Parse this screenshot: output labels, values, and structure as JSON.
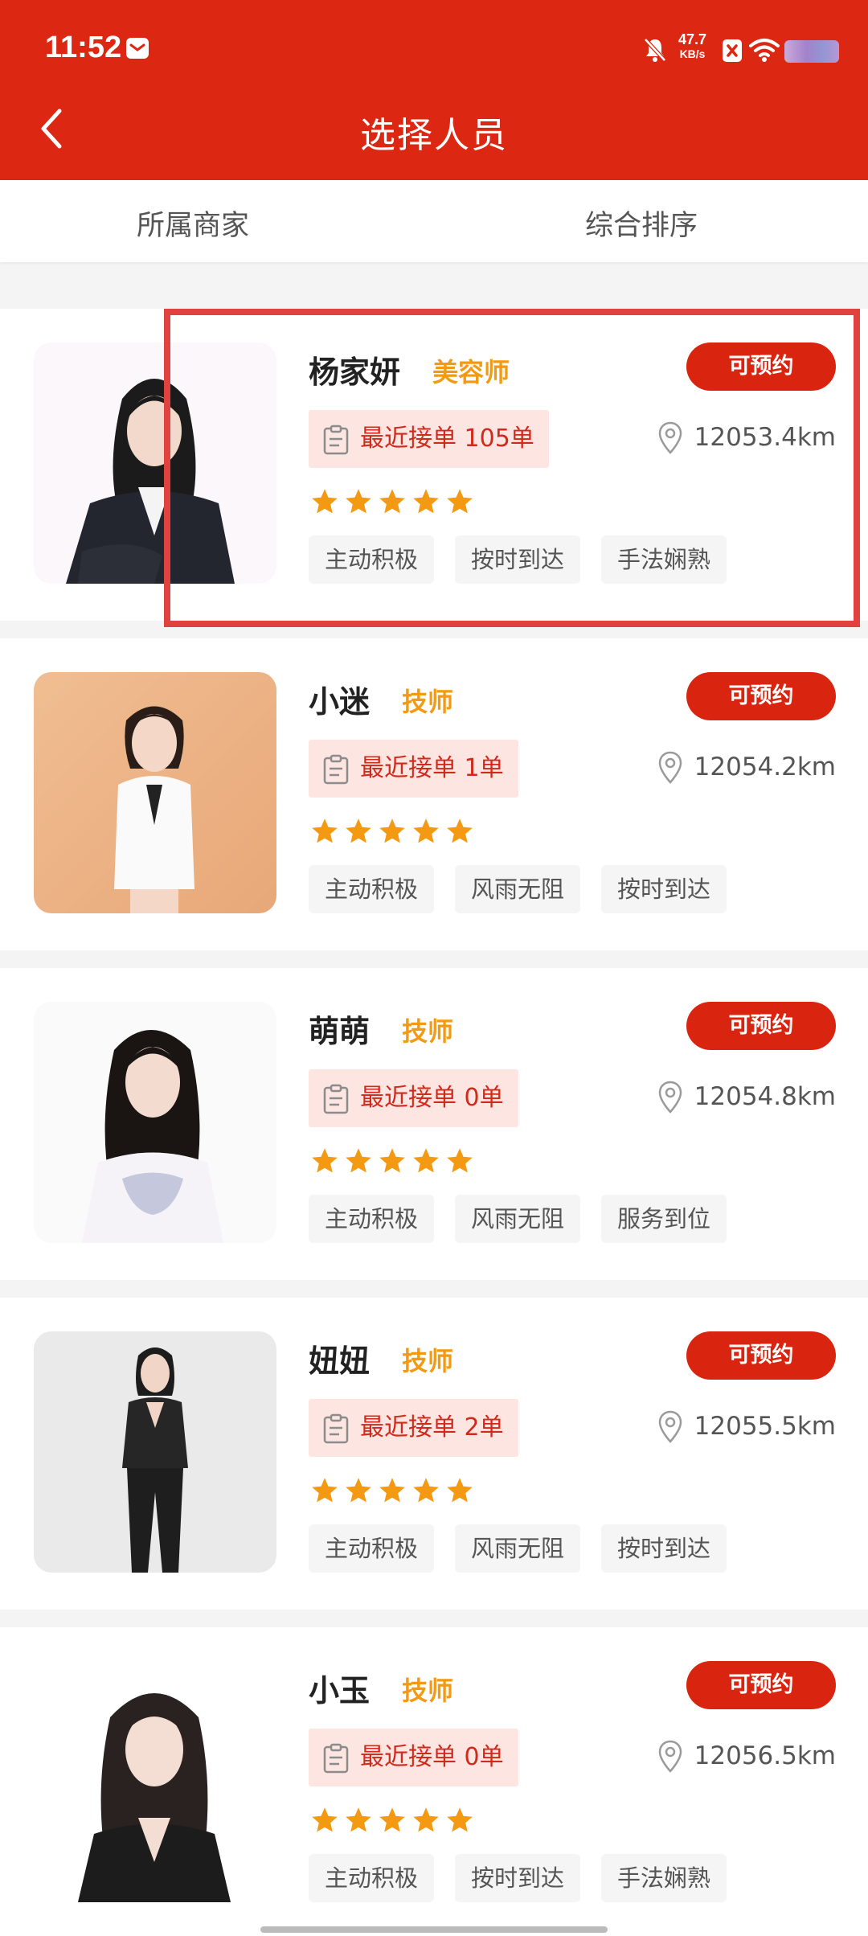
{
  "status_bar": {
    "time": "11:52",
    "net_speed_value": "47.7",
    "net_speed_unit": "KB/s"
  },
  "header": {
    "title": "选择人员"
  },
  "filters": [
    {
      "label": "所属商家"
    },
    {
      "label": "综合排序"
    }
  ],
  "colors": {
    "brand_red": "#dc2712",
    "role_orange": "#f39a12",
    "star_orange": "#f39a12"
  },
  "staff": [
    {
      "name": "杨家妍",
      "role": "美容师",
      "book_label": "可预约",
      "orders": "最近接单 105单",
      "distance": "12053.4km",
      "rating": 5,
      "tags": [
        "主动积极",
        "按时到达",
        "手法娴熟"
      ]
    },
    {
      "name": "小迷",
      "role": "技师",
      "book_label": "可预约",
      "orders": "最近接单 1单",
      "distance": "12054.2km",
      "rating": 5,
      "tags": [
        "主动积极",
        "风雨无阻",
        "按时到达"
      ]
    },
    {
      "name": "萌萌",
      "role": "技师",
      "book_label": "可预约",
      "orders": "最近接单 0单",
      "distance": "12054.8km",
      "rating": 5,
      "tags": [
        "主动积极",
        "风雨无阻",
        "服务到位"
      ]
    },
    {
      "name": "妞妞",
      "role": "技师",
      "book_label": "可预约",
      "orders": "最近接单 2单",
      "distance": "12055.5km",
      "rating": 5,
      "tags": [
        "主动积极",
        "风雨无阻",
        "按时到达"
      ]
    },
    {
      "name": "小玉",
      "role": "技师",
      "book_label": "可预约",
      "orders": "最近接单 0单",
      "distance": "12056.5km",
      "rating": 5,
      "tags": [
        "主动积极",
        "按时到达",
        "手法娴熟"
      ]
    }
  ]
}
